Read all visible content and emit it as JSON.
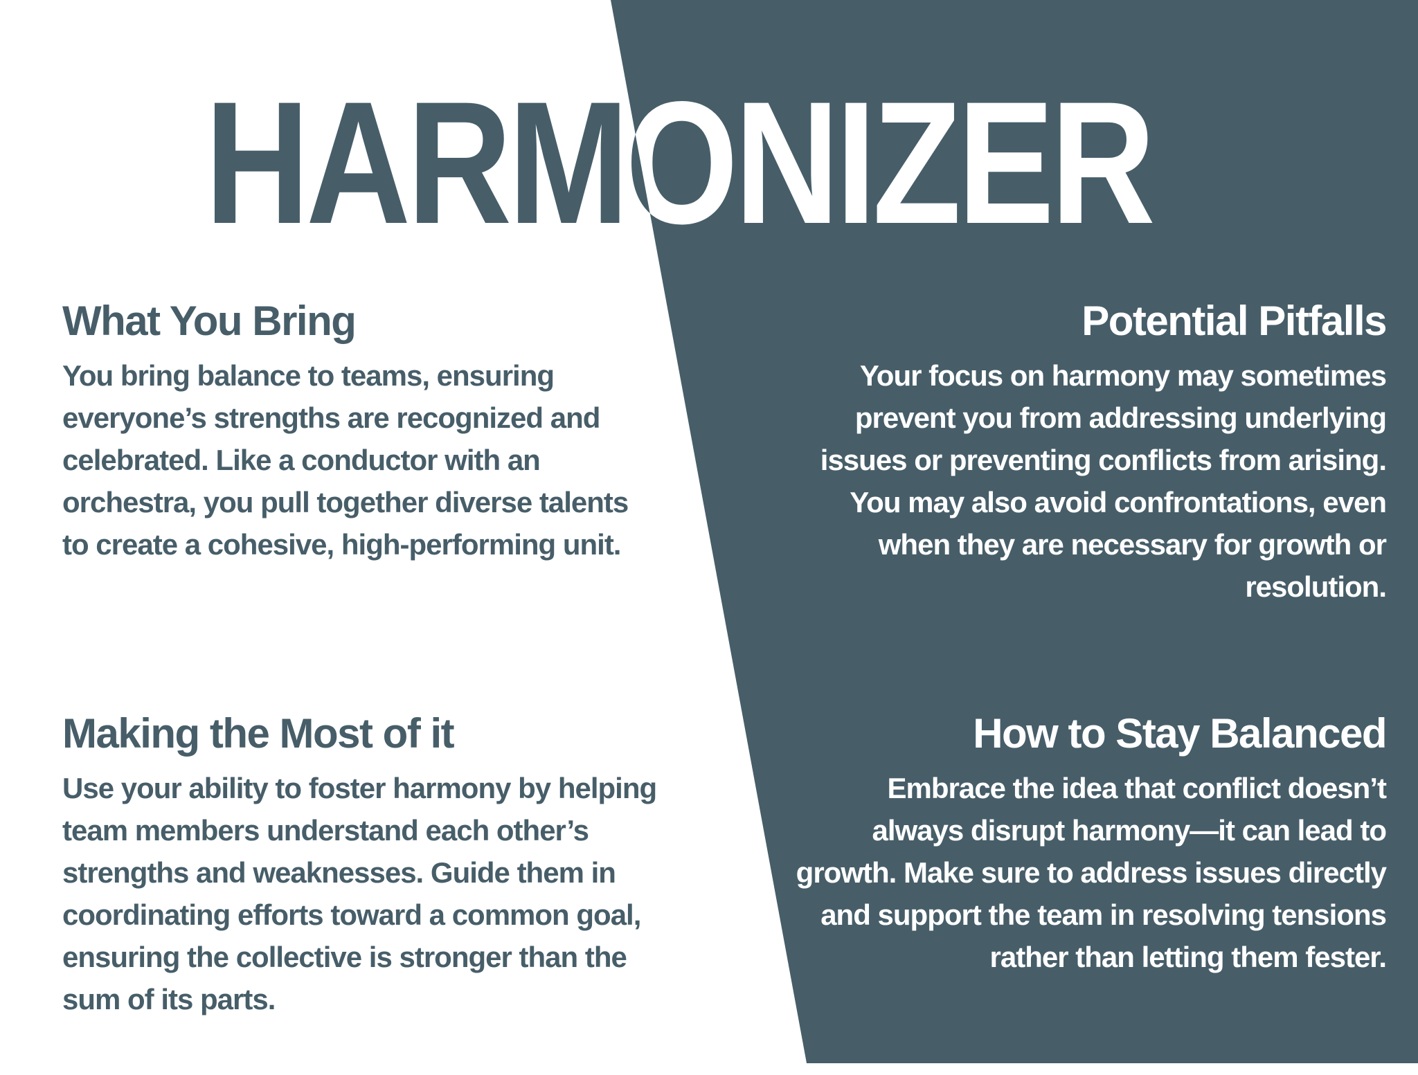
{
  "title": "HARMONIZER",
  "colors": {
    "panel": "#475e69",
    "background": "#ffffff"
  },
  "sections": {
    "what_you_bring": {
      "heading": "What You Bring",
      "body": "You bring balance to teams, ensuring everyone’s strengths are recognized and celebrated. Like a conductor with an orchestra, you pull together diverse talents to create a cohesive, high-performing unit."
    },
    "potential_pitfalls": {
      "heading": "Potential Pitfalls",
      "body": "Your focus on harmony may sometimes prevent you from addressing underlying issues or preventing conflicts from arising. You may also avoid confrontations, even when they are necessary for growth or resolution."
    },
    "making_the_most": {
      "heading": "Making the Most of it",
      "body": "Use your ability to foster harmony by helping team members understand each other’s strengths and weaknesses. Guide them in coordinating efforts toward a common goal, ensuring the collective is stronger than the sum of its parts."
    },
    "stay_balanced": {
      "heading": "How to Stay Balanced",
      "body": "Embrace the idea that conflict doesn’t always disrupt harmony—it can lead to growth. Make sure to address issues directly and support the team in resolving tensions rather than letting them fester."
    }
  }
}
